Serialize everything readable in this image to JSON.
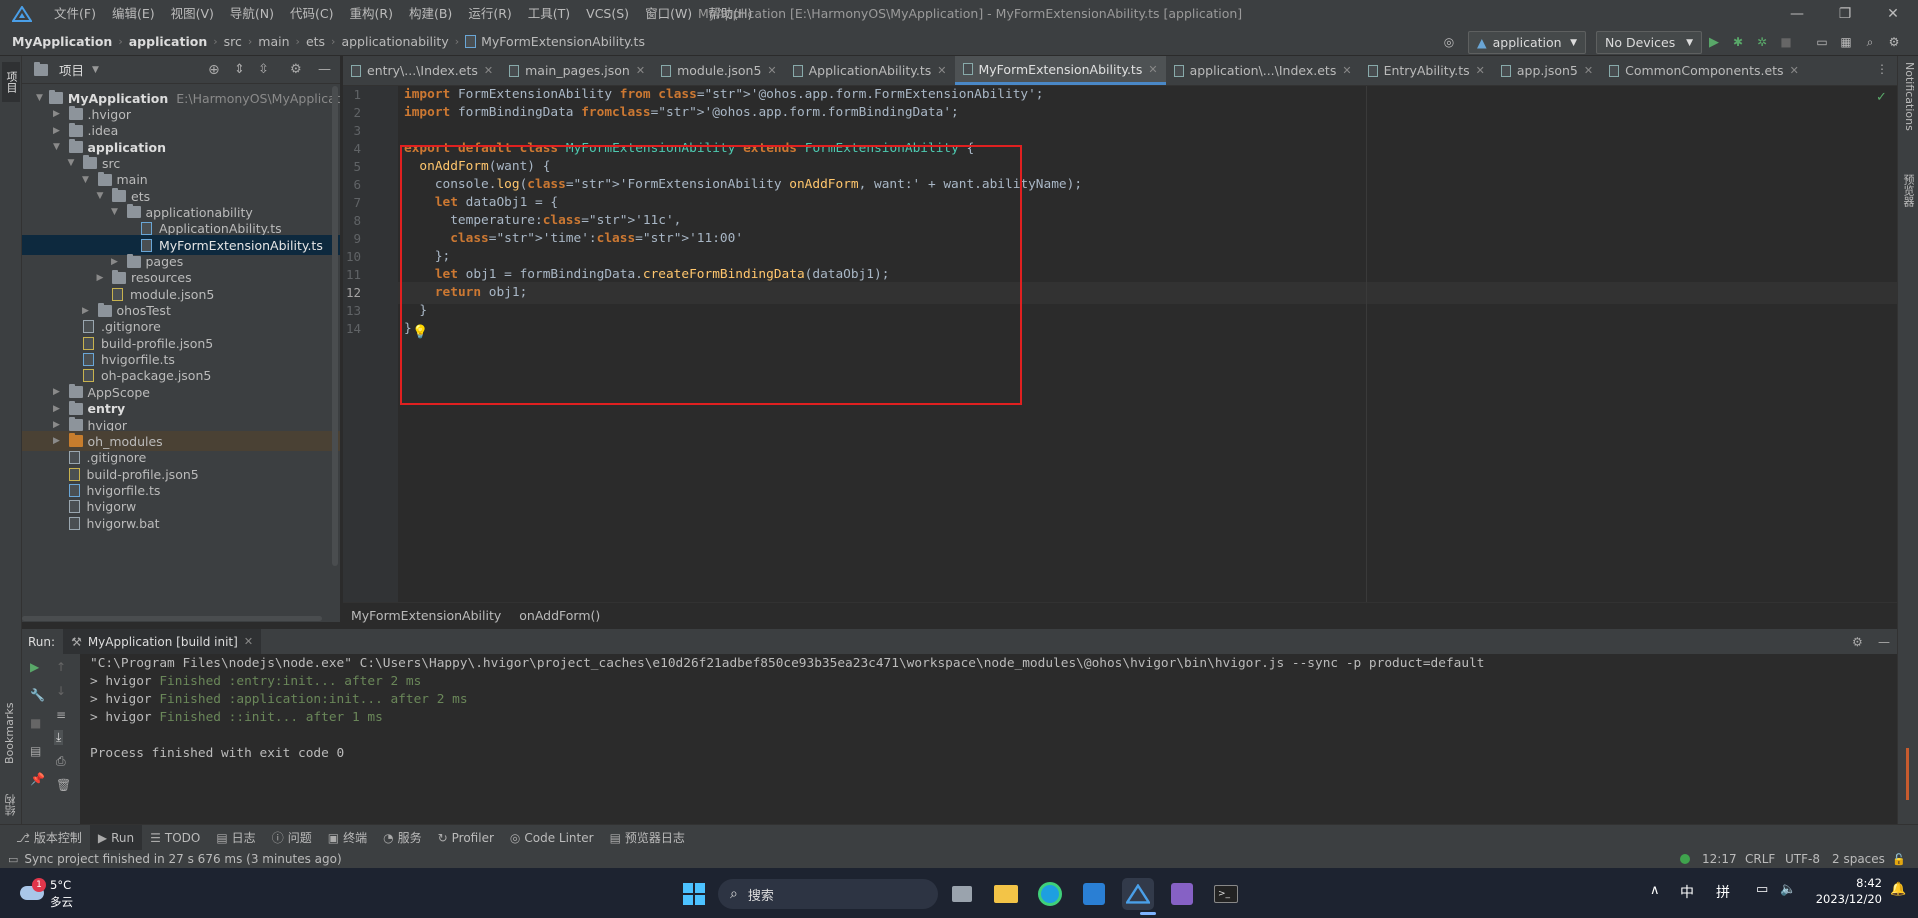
{
  "menu": [
    "文件(F)",
    "编辑(E)",
    "视图(V)",
    "导航(N)",
    "代码(C)",
    "重构(R)",
    "构建(B)",
    "运行(R)",
    "工具(T)",
    "VCS(S)",
    "窗口(W)",
    "帮助(H)"
  ],
  "window_title": "MyApplication [E:\\HarmonyOS\\MyApplication] - MyFormExtensionAbility.ts [application]",
  "breadcrumbs": [
    "MyApplication",
    "application",
    "src",
    "main",
    "ets",
    "applicationability",
    "MyFormExtensionAbility.ts"
  ],
  "toolbar": {
    "config": "application",
    "device": "No Devices"
  },
  "project_panel": {
    "title": "项目",
    "tree": [
      {
        "label": "MyApplication",
        "extra": "E:\\HarmonyOS\\MyApplication",
        "depth": 0,
        "type": "folder",
        "expanded": true,
        "bold": true
      },
      {
        "label": ".hvigor",
        "depth": 1,
        "type": "folder",
        "expanded": false
      },
      {
        "label": ".idea",
        "depth": 1,
        "type": "folder",
        "expanded": false
      },
      {
        "label": "application",
        "depth": 1,
        "type": "folder",
        "expanded": true,
        "bold": true
      },
      {
        "label": "src",
        "depth": 2,
        "type": "folder",
        "expanded": true
      },
      {
        "label": "main",
        "depth": 3,
        "type": "folder",
        "expanded": true
      },
      {
        "label": "ets",
        "depth": 4,
        "type": "folder",
        "expanded": true
      },
      {
        "label": "applicationability",
        "depth": 5,
        "type": "folder",
        "expanded": true
      },
      {
        "label": "ApplicationAbility.ts",
        "depth": 6,
        "type": "ts"
      },
      {
        "label": "MyFormExtensionAbility.ts",
        "depth": 6,
        "type": "ts",
        "selected": true
      },
      {
        "label": "pages",
        "depth": 5,
        "type": "folder",
        "expanded": false
      },
      {
        "label": "resources",
        "depth": 4,
        "type": "folder",
        "expanded": false
      },
      {
        "label": "module.json5",
        "depth": 4,
        "type": "json"
      },
      {
        "label": "ohosTest",
        "depth": 3,
        "type": "folder",
        "expanded": false
      },
      {
        "label": ".gitignore",
        "depth": 2,
        "type": "file"
      },
      {
        "label": "build-profile.json5",
        "depth": 2,
        "type": "json"
      },
      {
        "label": "hvigorfile.ts",
        "depth": 2,
        "type": "ts"
      },
      {
        "label": "oh-package.json5",
        "depth": 2,
        "type": "json"
      },
      {
        "label": "AppScope",
        "depth": 1,
        "type": "folder",
        "expanded": false
      },
      {
        "label": "entry",
        "depth": 1,
        "type": "folder",
        "expanded": false,
        "bold": true
      },
      {
        "label": "hvigor",
        "depth": 1,
        "type": "folder",
        "expanded": false
      },
      {
        "label": "oh_modules",
        "depth": 1,
        "type": "folder-orange",
        "expanded": false,
        "hl": true
      },
      {
        "label": ".gitignore",
        "depth": 1,
        "type": "file"
      },
      {
        "label": "build-profile.json5",
        "depth": 1,
        "type": "json"
      },
      {
        "label": "hvigorfile.ts",
        "depth": 1,
        "type": "ts"
      },
      {
        "label": "hvigorw",
        "depth": 1,
        "type": "file"
      },
      {
        "label": "hvigorw.bat",
        "depth": 1,
        "type": "file"
      }
    ]
  },
  "tabs": [
    "entry\\...\\Index.ets",
    "main_pages.json",
    "module.json5",
    "ApplicationAbility.ts",
    "MyFormExtensionAbility.ts",
    "application\\...\\Index.ets",
    "EntryAbility.ts",
    "app.json5",
    "CommonComponents.ets"
  ],
  "active_tab": 4,
  "code_lines": [
    "import FormExtensionAbility from '@ohos.app.form.FormExtensionAbility';",
    "import formBindingData from'@ohos.app.form.formBindingData';",
    "",
    "export default class MyFormExtensionAbility extends FormExtensionAbility {",
    "  onAddForm(want) {",
    "    console.log('FormExtensionAbility onAddForm, want:' + want.abilityName);",
    "    let dataObj1 = {",
    "      temperature:'11c',",
    "      'time':'11:00'",
    "    };",
    "    let obj1 = formBindingData.createFormBindingData(dataObj1);",
    "    return obj1;",
    "  }",
    "}"
  ],
  "current_line": 12,
  "editor_breadcrumb": [
    "MyFormExtensionAbility",
    "onAddForm()"
  ],
  "run_panel": {
    "label": "Run:",
    "tab": "MyApplication [build init]",
    "lines": [
      {
        "text": "\"C:\\Program Files\\nodejs\\node.exe\" C:\\Users\\Happy\\.hvigor\\project_caches\\e10d26f21adbef850ce93b35ea23c471\\workspace\\node_modules\\@ohos\\hvigor\\bin\\hvigor.js --sync -p product=default"
      },
      {
        "prefix": "> hvigor ",
        "ok": "Finished :entry:init... after 2 ms"
      },
      {
        "prefix": "> hvigor ",
        "ok": "Finished :application:init... after 2 ms"
      },
      {
        "prefix": "> hvigor ",
        "ok": "Finished ::init... after 1 ms"
      },
      {
        "text": ""
      },
      {
        "text": "Process finished with exit code 0"
      }
    ]
  },
  "bottom_tabs": [
    "版本控制",
    "Run",
    "TODO",
    "日志",
    "问题",
    "终端",
    "服务",
    "Profiler",
    "Code Linter",
    "预览器日志"
  ],
  "status": {
    "message": "Sync project finished in 27 s 676 ms (3 minutes ago)",
    "position": "12:17",
    "line_sep": "CRLF",
    "encoding": "UTF-8",
    "indent": "2 spaces"
  },
  "side_labels": {
    "left_top": "项目",
    "bookmarks": "Bookmarks",
    "left_bottom": "结构",
    "notifications": "Notifications",
    "preview": "预览器"
  },
  "taskbar": {
    "weather_temp": "5°C",
    "weather_desc": "多云",
    "weather_badge": "1",
    "search": "搜索",
    "ime1": "中",
    "ime2": "拼",
    "time": "8:42",
    "date": "2023/12/20"
  }
}
